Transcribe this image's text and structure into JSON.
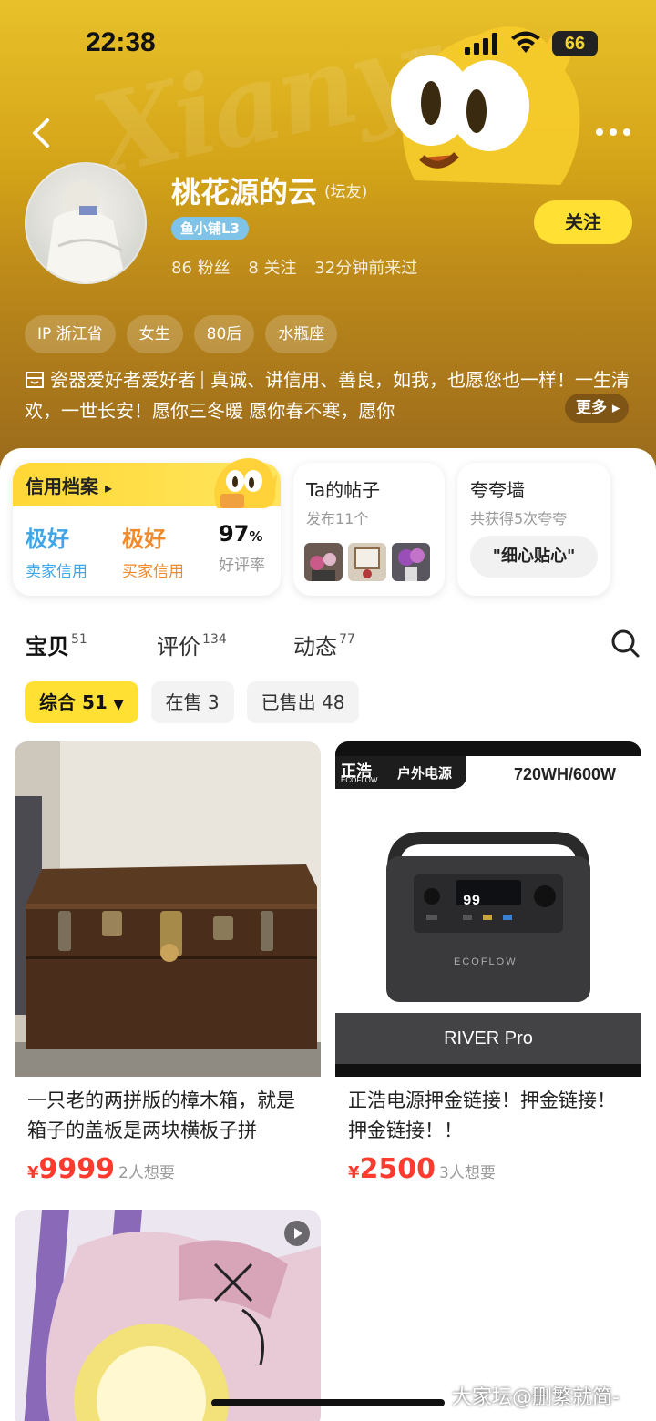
{
  "status_bar": {
    "time": "22:38",
    "battery": "66"
  },
  "header": {
    "background_word": "Xianyu",
    "username": "桃花源的云",
    "role": "(坛友)",
    "level": "鱼小铺L3",
    "stats": {
      "fans": "86 粉丝",
      "following": "8 关注",
      "last_seen": "32分钟前来过"
    },
    "follow_label": "关注",
    "tags": [
      "IP 浙江省",
      "女生",
      "80后",
      "水瓶座"
    ],
    "bio_prefix": "瓷器爱好者爱好者",
    "bio_text": "真诚、讲信用、善良，如我，也愿您也一样！一生清欢，一世长安！愿你三冬暖 愿你春不寒，愿你",
    "more_label": "更多"
  },
  "credit": {
    "title": "信用档案",
    "seller": {
      "value": "极好",
      "label": "卖家信用",
      "color": "#3fa6e8"
    },
    "buyer": {
      "value": "极好",
      "label": "买家信用",
      "color": "#f08a2a"
    },
    "rating": {
      "value": "97",
      "unit": "%",
      "label": "好评率"
    }
  },
  "posts": {
    "title": "Ta的帖子",
    "subtitle": "发布11个"
  },
  "praise": {
    "title": "夸夸墙",
    "subtitle": "共获得5次夸夸",
    "pill": "\"细心贴心\""
  },
  "tabs": [
    {
      "label": "宝贝",
      "count": "51"
    },
    {
      "label": "评价",
      "count": "134"
    },
    {
      "label": "动态",
      "count": "77"
    }
  ],
  "filters": [
    "综合 51",
    "在售 3",
    "已售出 48"
  ],
  "products": [
    {
      "title": "一只老的两拼版的樟木箱，就是箱子的盖板是两块横板子拼",
      "currency": "¥",
      "price": "9999",
      "wants": "2人想要"
    },
    {
      "title": "正浩电源押金链接！押金链接！押金链接！！",
      "currency": "¥",
      "price": "2500",
      "wants": "3人想要",
      "image_text": {
        "brand_cn": "正浩",
        "brand_en": "ECOFLOW",
        "category": "户外电源",
        "spec": "720WH/600W",
        "model": "RIVER Pro",
        "logo": "ECOFLOW",
        "display": "99"
      }
    }
  ],
  "watermark": "大家坛@删繁就简-"
}
